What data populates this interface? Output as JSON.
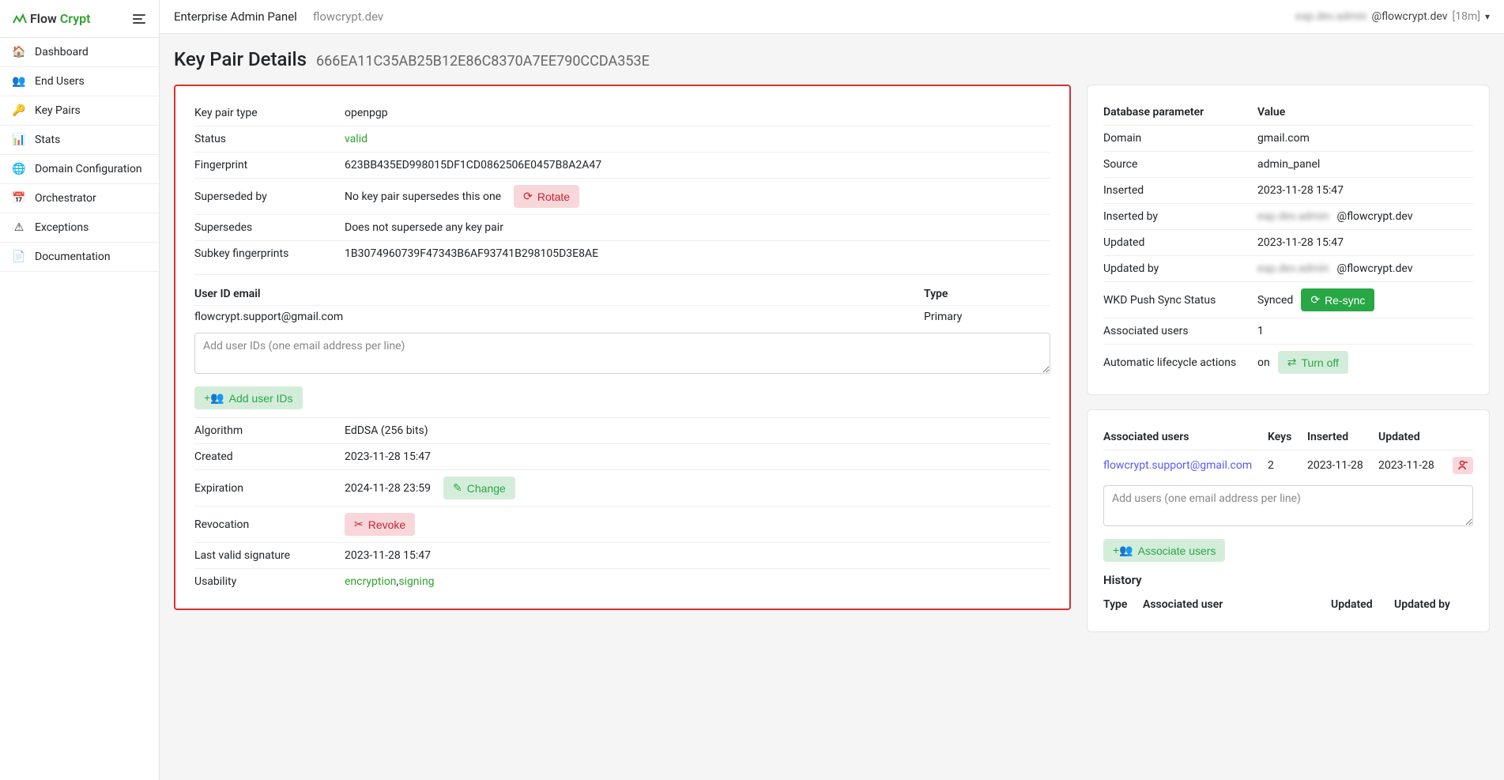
{
  "logo": {
    "flow": "Flow",
    "crypt": "Crypt"
  },
  "nav": {
    "items": [
      {
        "label": "Dashboard",
        "icon": "home"
      },
      {
        "label": "End Users",
        "icon": "users"
      },
      {
        "label": "Key Pairs",
        "icon": "key"
      },
      {
        "label": "Stats",
        "icon": "stats"
      },
      {
        "label": "Domain Configuration",
        "icon": "globe"
      },
      {
        "label": "Orchestrator",
        "icon": "calendar"
      },
      {
        "label": "Exceptions",
        "icon": "warning"
      },
      {
        "label": "Documentation",
        "icon": "doc"
      }
    ]
  },
  "topbar": {
    "title": "Enterprise Admin Panel",
    "sub": "flowcrypt.dev",
    "user_blurred": "eap.dev.admin",
    "user_domain": "@flowcrypt.dev",
    "session": "[18m]"
  },
  "page": {
    "title": "Key Pair Details",
    "fingerprint": "666EA11C35AB25B12E86C8370A7EE790CCDA353E"
  },
  "details": {
    "key_pair_type_label": "Key pair type",
    "key_pair_type": "openpgp",
    "status_label": "Status",
    "status": "valid",
    "fingerprint_label": "Fingerprint",
    "fingerprint": "623BB435ED998015DF1CD0862506E0457B8A2A47",
    "superseded_by_label": "Superseded by",
    "superseded_by": "No key pair supersedes this one",
    "rotate_btn": "Rotate",
    "supersedes_label": "Supersedes",
    "supersedes": "Does not supersede any key pair",
    "subkey_label": "Subkey fingerprints",
    "subkey": "1B3074960739F47343B6AF93741B298105D3E8AE",
    "userid_header_email": "User ID email",
    "userid_header_type": "Type",
    "userid_email": "flowcrypt.support@gmail.com",
    "userid_type": "Primary",
    "add_userids_placeholder": "Add user IDs (one email address per line)",
    "add_userids_btn": "Add user IDs",
    "algorithm_label": "Algorithm",
    "algorithm": "EdDSA (256 bits)",
    "created_label": "Created",
    "created": "2023-11-28 15:47",
    "expiration_label": "Expiration",
    "expiration": "2024-11-28 23:59",
    "change_btn": "Change",
    "revocation_label": "Revocation",
    "revoke_btn": "Revoke",
    "last_valid_sig_label": "Last valid signature",
    "last_valid_sig": "2023-11-28 15:47",
    "usability_label": "Usability",
    "usability_enc": "encryption",
    "usability_sep": ", ",
    "usability_sign": "signing"
  },
  "db": {
    "header_param": "Database parameter",
    "header_value": "Value",
    "domain_label": "Domain",
    "domain": "gmail.com",
    "source_label": "Source",
    "source": "admin_panel",
    "inserted_label": "Inserted",
    "inserted": "2023-11-28 15:47",
    "inserted_by_label": "Inserted by",
    "inserted_by_blurred": "eap.dev.admin",
    "inserted_by_domain": "@flowcrypt.dev",
    "updated_label": "Updated",
    "updated": "2023-11-28 15:47",
    "updated_by_label": "Updated by",
    "updated_by_blurred": "eap.dev.admin",
    "updated_by_domain": "@flowcrypt.dev",
    "wkd_label": "WKD Push Sync Status",
    "wkd_status": "Synced",
    "resync_btn": "Re-sync",
    "assoc_users_label": "Associated users",
    "assoc_users": "1",
    "lifecycle_label": "Automatic lifecycle actions",
    "lifecycle_status": "on",
    "turnoff_btn": "Turn off"
  },
  "assoc": {
    "header_users": "Associated users",
    "header_keys": "Keys",
    "header_inserted": "Inserted",
    "header_updated": "Updated",
    "row_user": "flowcrypt.support@gmail.com",
    "row_keys": "2",
    "row_inserted": "2023-11-28",
    "row_updated": "2023-11-28",
    "add_users_placeholder": "Add users (one email address per line)",
    "associate_btn": "Associate users",
    "history_header": "History",
    "history_col_type": "Type",
    "history_col_user": "Associated user",
    "history_col_updated": "Updated",
    "history_col_updated_by": "Updated by"
  }
}
